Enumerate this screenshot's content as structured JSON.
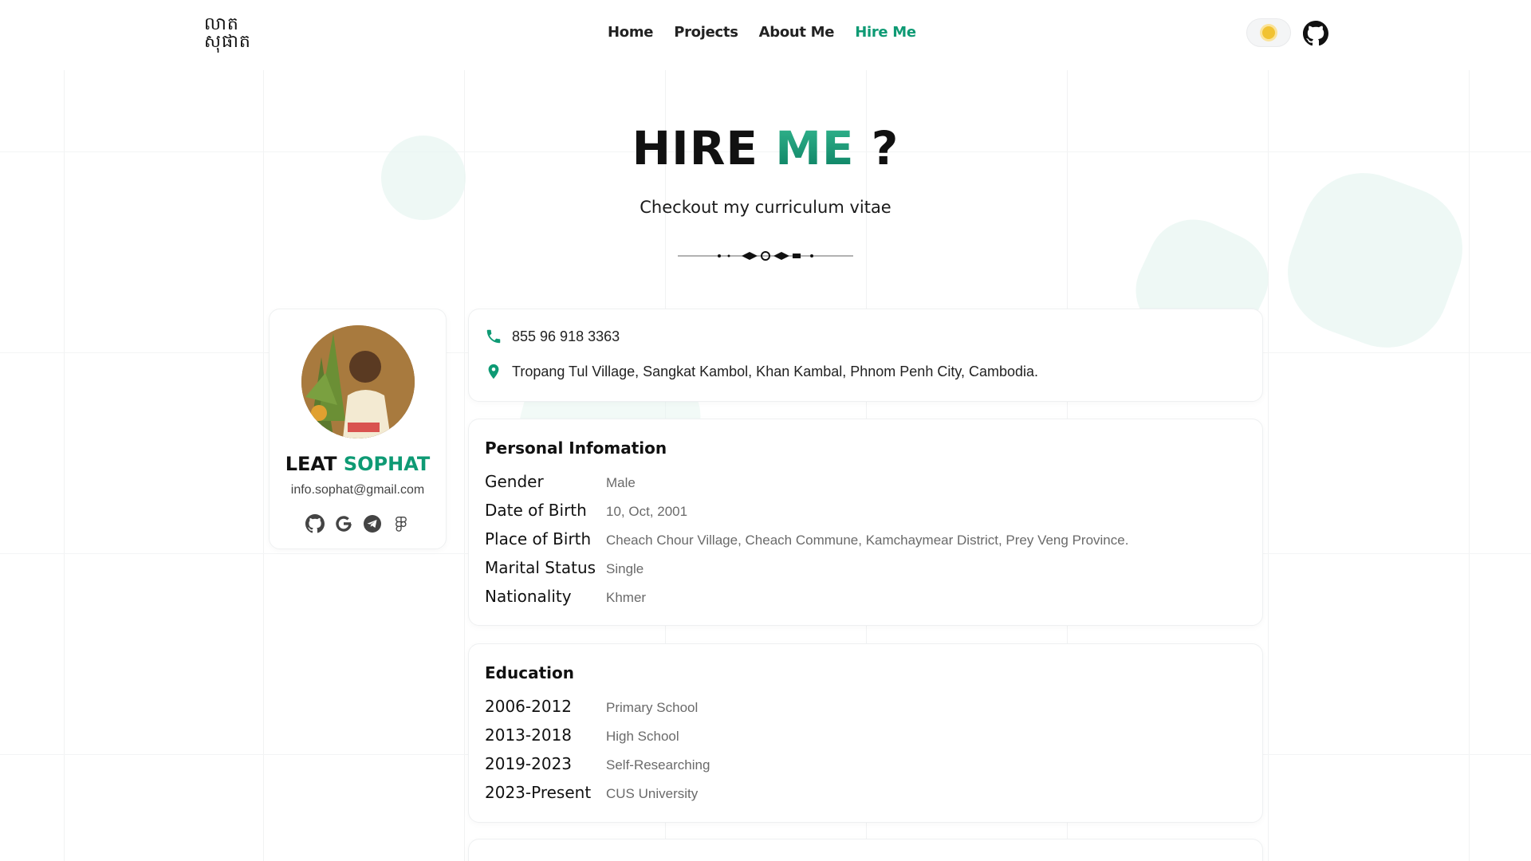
{
  "header": {
    "logo_line1": "លាត",
    "logo_line2": "សុផាត",
    "nav": [
      {
        "label": "Home"
      },
      {
        "label": "Projects"
      },
      {
        "label": "About Me"
      },
      {
        "label": "Hire Me",
        "active": true
      }
    ],
    "icons": {
      "theme": "sun-icon",
      "github": "github-icon"
    }
  },
  "hero": {
    "title_part1": "HIRE",
    "title_part2": "ME",
    "title_part3": "?",
    "subtitle": "Checkout my curriculum vitae"
  },
  "profile": {
    "last_name": "LEAT",
    "first_name": "SOPHAT",
    "email": "info.sophat@gmail.com",
    "socials": [
      "github-icon",
      "google-icon",
      "telegram-icon",
      "figma-icon"
    ]
  },
  "contact": {
    "phone": "855 96 918 3363",
    "address": "Tropang Tul Village, Sangkat Kambol, Khan Kambal, Phnom Penh City, Cambodia."
  },
  "personal": {
    "title": "Personal Infomation",
    "rows": [
      {
        "label": "Gender",
        "value": "Male"
      },
      {
        "label": "Date of Birth",
        "value": "10, Oct, 2001"
      },
      {
        "label": "Place of Birth",
        "value": "Cheach Chour Village, Cheach Commune, Kamchaymear District, Prey Veng Province."
      },
      {
        "label": "Marital Status",
        "value": "Single"
      },
      {
        "label": "Nationality",
        "value": "Khmer"
      }
    ]
  },
  "education": {
    "title": "Education",
    "rows": [
      {
        "label": "2006-2012",
        "value": "Primary School"
      },
      {
        "label": "2013-2018",
        "value": "High School"
      },
      {
        "label": "2019-2023",
        "value": "Self-Researching"
      },
      {
        "label": "2023-Present",
        "value": "CUS University"
      }
    ]
  },
  "colors": {
    "accent": "#0e9a74",
    "text": "#111111",
    "muted": "#6a6a6a"
  }
}
